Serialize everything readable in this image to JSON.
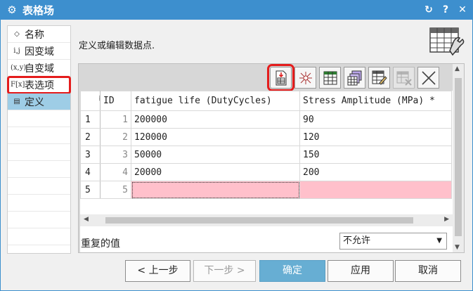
{
  "window": {
    "title": "表格场",
    "controls": [
      "↻",
      "?",
      "✕"
    ]
  },
  "sidebar": {
    "items": [
      {
        "label": "名称",
        "icon": "tag-icon",
        "glyph": "◇"
      },
      {
        "label": "因变域",
        "icon": "dependent-var-icon",
        "glyph": "i,j"
      },
      {
        "label": "自变域",
        "icon": "independent-var-icon",
        "glyph": "(x,y)"
      },
      {
        "label": "表选项",
        "icon": "function-icon",
        "glyph": "F[x]"
      },
      {
        "label": "定义",
        "icon": "edit-table-icon",
        "glyph": "▤"
      }
    ]
  },
  "content": {
    "instruction": "定义或编辑数据点."
  },
  "table": {
    "columns": [
      "ID",
      "fatigue life (DutyCycles)",
      "Stress Amplitude (MPa) *"
    ],
    "rows": [
      {
        "row_num": "1",
        "id": "1",
        "c1": "200000",
        "c2": "90"
      },
      {
        "row_num": "2",
        "id": "2",
        "c1": "120000",
        "c2": "120"
      },
      {
        "row_num": "3",
        "id": "3",
        "c1": "50000",
        "c2": "150"
      },
      {
        "row_num": "4",
        "id": "4",
        "c1": "20000",
        "c2": "200"
      },
      {
        "row_num": "5",
        "id": "5",
        "c1": "",
        "c2": ""
      }
    ]
  },
  "duplicates": {
    "label": "重复的值",
    "selected": "不允许"
  },
  "buttons": {
    "back": "< 上一步",
    "next": "下一步 >",
    "ok": "确定",
    "apply": "应用",
    "cancel": "取消"
  },
  "colors": {
    "titlebar": "#3d8fce",
    "active_nav": "#9ecde6",
    "pending_row": "#ffc0cb",
    "primary_button": "#67aed3",
    "highlight": "#e41c1c"
  }
}
